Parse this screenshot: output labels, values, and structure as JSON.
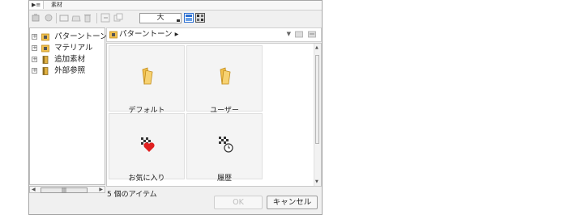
{
  "tabs": [
    "▶≡",
    "素材"
  ],
  "toolbar": {
    "size_label": "大"
  },
  "tree": {
    "items": [
      {
        "label": "パターントーン",
        "icon": "folder-camera-icon"
      },
      {
        "label": "マテリアル",
        "icon": "folder-camera-icon"
      },
      {
        "label": "追加素材",
        "icon": "material-book-icon"
      },
      {
        "label": "外部参照",
        "icon": "material-book-icon"
      }
    ]
  },
  "path": {
    "label": "パターントーン ▸"
  },
  "grid": {
    "items": [
      {
        "label": "デフォルト",
        "icon": "folder-icon"
      },
      {
        "label": "ユーザー",
        "icon": "folder-icon"
      },
      {
        "label": "お気に入り",
        "icon": "favorite-icon"
      },
      {
        "label": "履歴",
        "icon": "history-icon"
      }
    ]
  },
  "status": {
    "count_text": "5 個のアイテム"
  },
  "buttons": {
    "ok": "OK",
    "cancel": "キャンセル"
  },
  "colors": {
    "folder": "#f3c24f",
    "heart": "#e02020",
    "accent": "#2c6fd1"
  }
}
